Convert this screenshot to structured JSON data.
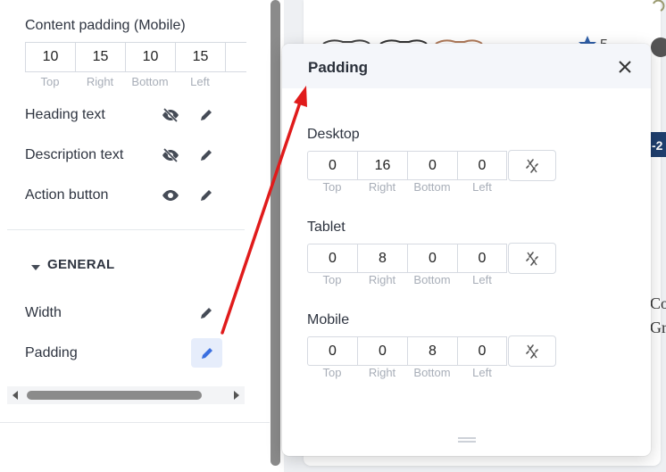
{
  "left_panel": {
    "content_padding_label": "Content padding (Mobile)",
    "content_padding_values": [
      "10",
      "15",
      "10",
      "15"
    ],
    "content_padding_captions": [
      "Top",
      "Right",
      "Bottom",
      "Left"
    ],
    "rows": [
      {
        "label": "Heading text",
        "visibility": "eye-off-icon"
      },
      {
        "label": "Description text",
        "visibility": "eye-off-icon"
      },
      {
        "label": "Action button",
        "visibility": "eye-icon"
      }
    ],
    "general_heading": "GENERAL",
    "width_label": "Width",
    "padding_label": "Padding"
  },
  "popup": {
    "title": "Padding",
    "close_icon": "close-icon",
    "captions": [
      "Top",
      "Right",
      "Bottom",
      "Left"
    ],
    "desktop": {
      "label": "Desktop",
      "values": [
        "0",
        "16",
        "0",
        "0"
      ]
    },
    "tablet": {
      "label": "Tablet",
      "values": [
        "0",
        "8",
        "0",
        "0"
      ]
    },
    "mobile": {
      "label": "Mobile",
      "values": [
        "0",
        "0",
        "8",
        "0"
      ]
    }
  },
  "colors": {
    "accent": "#3a6fe0",
    "annotation_arrow": "#e01b1b",
    "badge": "#1f3f6e"
  }
}
